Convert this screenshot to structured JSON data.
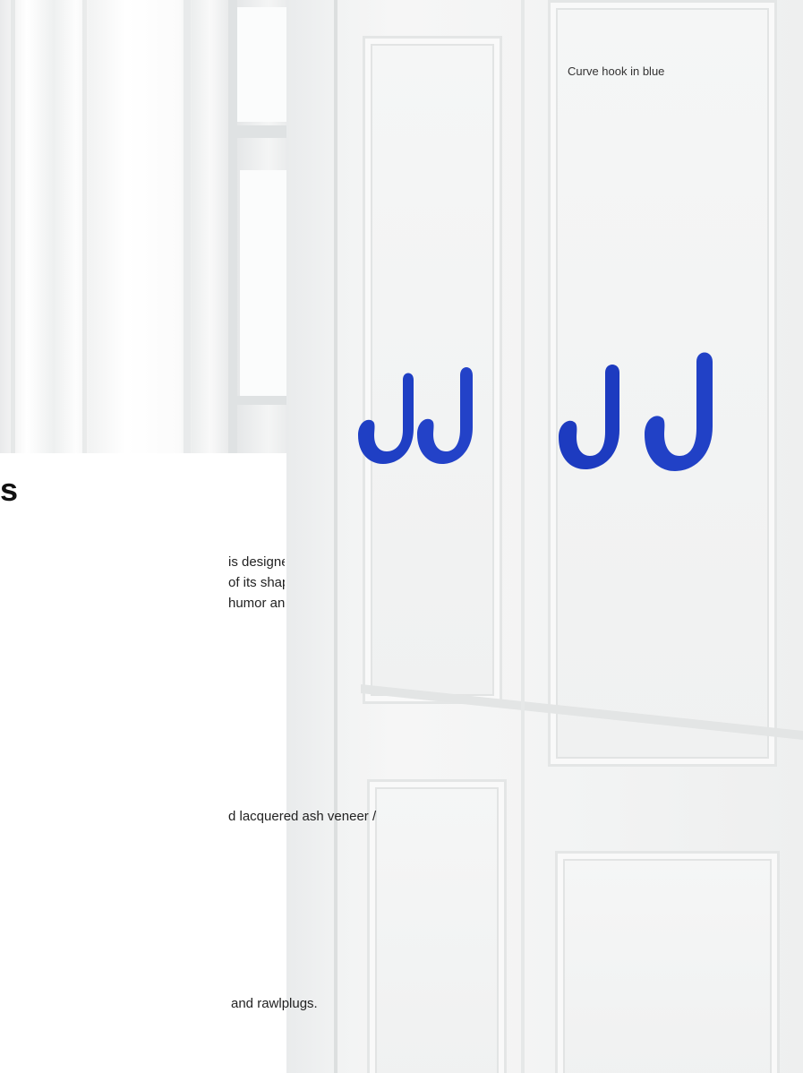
{
  "caption": "Curve hook in blue",
  "title_fragment": "s",
  "description": "is designed a wooden hook\nof its shape and the defined\nhumor and personality to the",
  "material_text": "d lacquered ash veneer /",
  "mounting_text": "and rawlplugs.",
  "colors": {
    "hook_blue": "#1f3fc4",
    "wall": "#f3f4f4"
  },
  "icons": [
    "curve-hook-icon"
  ]
}
